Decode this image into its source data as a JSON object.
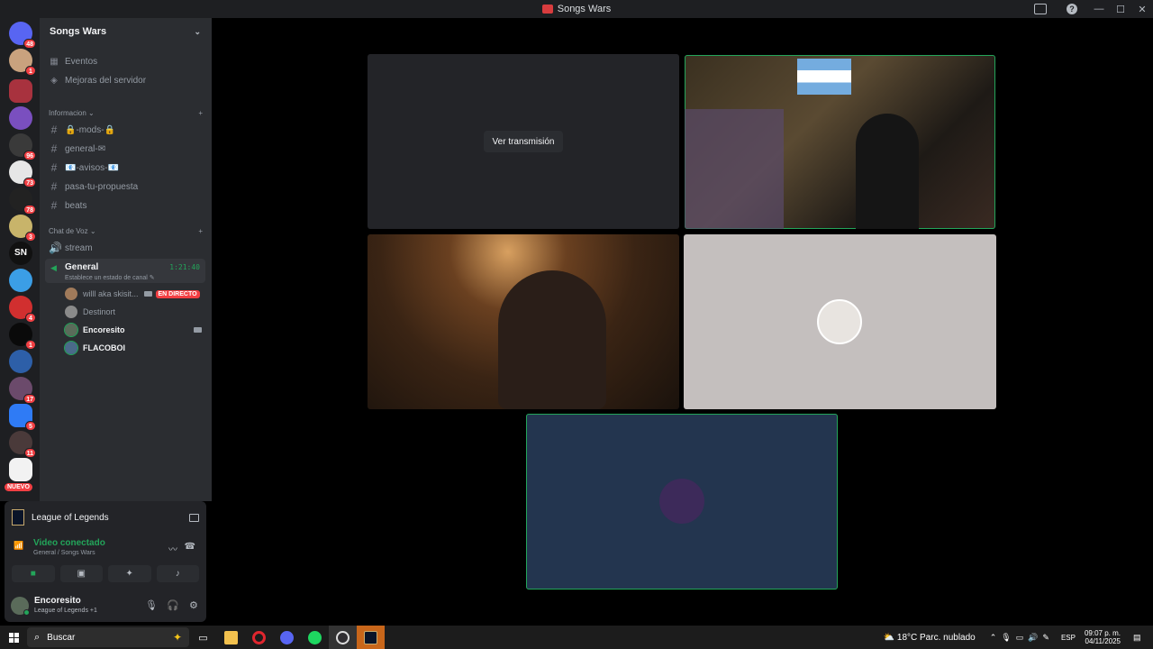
{
  "window": {
    "title": "Songs Wars"
  },
  "server": {
    "name": "Songs Wars"
  },
  "nav": {
    "events": "Eventos",
    "boosts": "Mejoras del servidor"
  },
  "categories": {
    "info": "Informacion",
    "voice": "Chat de Voz"
  },
  "text_channels": [
    "🔒-mods-🔒",
    "general-✉",
    "📧-avisos-📧",
    "pasa-tu-propuesta",
    "beats"
  ],
  "voice_channels": {
    "stream": "stream",
    "general": "General",
    "timer": "1:21:40",
    "status": "Establece un estado de canal"
  },
  "voice_users": [
    {
      "name": "willl aka skisit...",
      "live": "EN DIRECTO"
    },
    {
      "name": "Destinort"
    },
    {
      "name": "Encoresito"
    },
    {
      "name": "FLACOBOI"
    }
  ],
  "guild_badges": [
    "48",
    "1",
    "96",
    "73",
    "78",
    "3",
    "4",
    "1",
    "17",
    "5",
    "11"
  ],
  "guild_nuevo": "NUEVO",
  "activity": {
    "game": "League of Legends"
  },
  "voice_connection": {
    "title": "Video conectado",
    "subtitle": "General / Songs Wars"
  },
  "user": {
    "name": "Encoresito",
    "status": "League of Legends +1"
  },
  "stage": {
    "watch_button": "Ver transmisión"
  },
  "taskbar": {
    "search_placeholder": "Buscar",
    "weather": "18°C  Parc. nublado",
    "lang": "ESP",
    "time": "09:07 p. m.",
    "date": "04/11/2025"
  },
  "colors": {
    "speaking": "#23a55a",
    "live": "#f23f43",
    "sidebar": "#2b2d31"
  }
}
